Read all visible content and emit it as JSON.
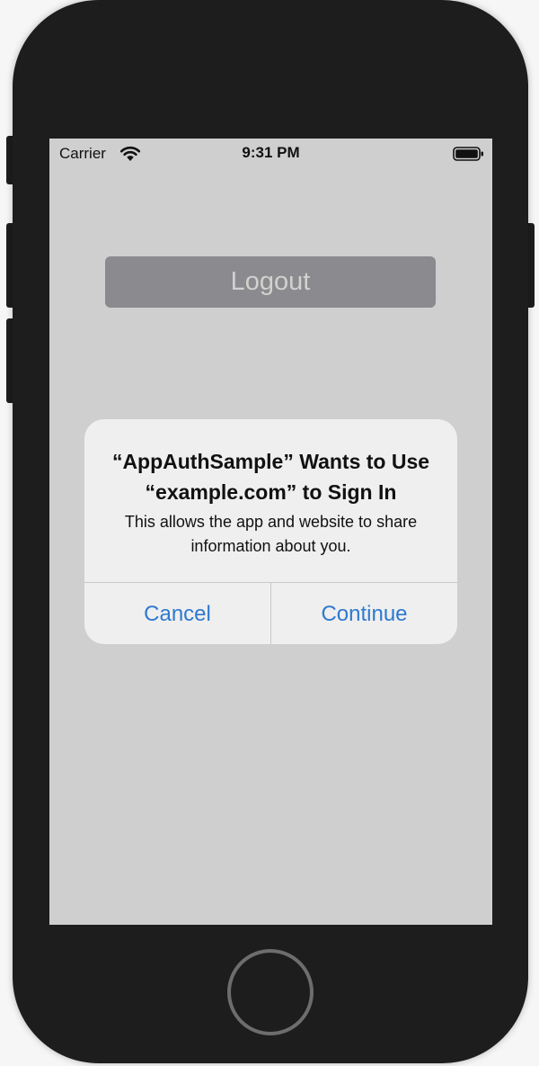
{
  "status_bar": {
    "carrier": "Carrier",
    "time": "9:31 PM",
    "wifi_icon": "wifi-icon",
    "battery_icon": "battery-full-icon"
  },
  "app": {
    "logout_label": "Logout"
  },
  "alert": {
    "title": "“AppAuthSample” Wants to Use “example.com” to Sign In",
    "message": "This allows the app and website to share information about you.",
    "cancel_label": "Cancel",
    "continue_label": "Continue"
  },
  "colors": {
    "screen_background": "#cfcfcf",
    "logout_button_background": "#8a8a8f",
    "alert_background": "#efefef",
    "action_text": "#2f79cf"
  }
}
